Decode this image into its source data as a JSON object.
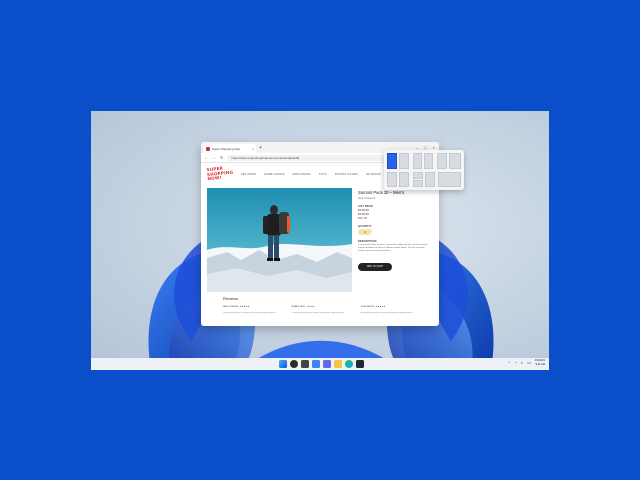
{
  "browser": {
    "tab_title": "Super Shopping Now",
    "tab_close": "×",
    "new_tab": "+",
    "url": "https://www.supershoppingnow.com/summitpack30",
    "window_controls": {
      "minimize": "–",
      "maximize": "□",
      "close": "×"
    },
    "nav_icons": [
      "back-icon",
      "forward-icon",
      "refresh-icon",
      "lock-icon"
    ]
  },
  "site": {
    "logo_lines": [
      "SUPER",
      "SHOPPING",
      "NOW!"
    ],
    "nav": [
      "SEA FINDS",
      "HOME GOODS",
      "APPLIANCES",
      "TOYS",
      "SPORTS GOODS",
      "OUTDOOR",
      "OUTDOOR"
    ]
  },
  "product": {
    "title": "Summit Pack 30 – Men's",
    "brand": "Ned Outdoors",
    "price_label": "LIST PRICE",
    "list_price": "$149.99",
    "sale_price": "$139.99",
    "you_save": "$10.00",
    "quantity_label": "QUANTITY",
    "quantity": "1",
    "description_label": "DESCRIPTION",
    "description": "Lorem ipsum dolor sit amet, consectetur adipiscing elit, sed do eiusmod tempor incididunt ut labore et dolore magna aliqua. Ut enim ad minim veniam, quis nostrud exercitation.",
    "cart_button": "ADD TO CART"
  },
  "reviews": {
    "title": "Reviews",
    "items": [
      {
        "name": "PAUL STEVEN • ★★★★★",
        "text": "Lorem ipsum dolor sit amet consectetur adipiscing elit."
      },
      {
        "name": "REBECCA M. • ★★★★",
        "text": "Lorem ipsum dolor sit amet consectetur adipiscing elit."
      },
      {
        "name": "JOHN SMITH • ★★★★★",
        "text": "Lorem ipsum dolor sit amet consectetur adipiscing elit."
      }
    ]
  },
  "taskbar": {
    "clock_time": "4/5/2021",
    "clock_date": "9:11 AM",
    "tray_icons": [
      "chevron-up-icon",
      "wifi-icon",
      "volume-icon",
      "battery-icon"
    ],
    "apps": [
      "start-icon",
      "search-icon",
      "task-view-icon",
      "widgets-icon",
      "chat-icon",
      "file-explorer-icon",
      "edge-icon",
      "store-icon"
    ]
  },
  "colors": {
    "background": "#0a4fc9",
    "accent": "#2563eb",
    "logo": "#d8332f"
  }
}
